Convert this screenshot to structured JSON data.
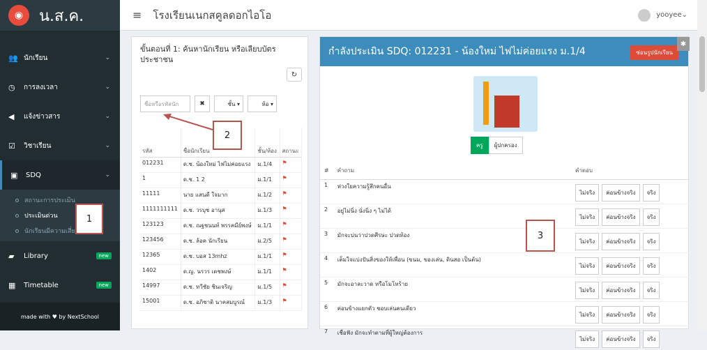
{
  "sidebar": {
    "brand": "น.ส.ค.",
    "items": [
      {
        "label": "นักเรียน"
      },
      {
        "label": "การลงเวลา"
      },
      {
        "label": "แจ้งข่าวสาร"
      },
      {
        "label": "วิชาเรียน"
      },
      {
        "label": "SDQ"
      }
    ],
    "sub": [
      {
        "label": "สถานะการประเมิน"
      },
      {
        "label": "ประเมินด่วน"
      },
      {
        "label": "นักเรียนมีความเสี่ยง"
      }
    ],
    "library": "Library",
    "timetable": "Timetable",
    "new_badge": "new",
    "made": "made with ♥ by NextSchool"
  },
  "topbar": {
    "school": "โรงเรียนเนกสคูลดอกไอโอ",
    "user": "yooyee"
  },
  "left": {
    "title": "ขั้นตอนที่ 1: ค้นหานักเรียน หรือเลียบบัตรประชาชน",
    "search_placeholder": "ชื่อหรือรหัสนัก",
    "grade": "ชั้น",
    "room": "ห้อ",
    "headers": [
      "รหัส",
      "ชื่อนักเรียน",
      "ชั้น/ห้อง",
      "สถานะ"
    ],
    "rows": [
      [
        "012231",
        "ด.ช. น้องใหม่ ไฟไม่ค่อยแรง",
        "ม.1/4"
      ],
      [
        "1",
        "ด.ช. 1 2",
        "ม.1/1"
      ],
      [
        "11111",
        "นาย แสนดี ใจมาก",
        "ม.1/2"
      ],
      [
        "1111111111",
        "ด.ช. วรบุช อานุส",
        "ม.1/3"
      ],
      [
        "123123",
        "ด.ช. ณฐชนนท์ พรรคมีย์พงษ์",
        "ม.1/1"
      ],
      [
        "123456",
        "ด.ช. ล้อค นักเรียน",
        "ม.2/5"
      ],
      [
        "12365",
        "ด.ช. บอส 13mhz",
        "ม.1/1"
      ],
      [
        "1402",
        "ด.ญ. นรวร เดชพงษ์",
        "ม.1/1"
      ],
      [
        "14997",
        "ด.ช. ทวีชัย ชินเจริญ",
        "ม.1/5"
      ],
      [
        "15001",
        "ด.ช. อภิชาติ นาคสมบูรณ์",
        "ม.1/3"
      ]
    ]
  },
  "right": {
    "title": "กำลังประเมิน SDQ: 012231 - น้องใหม่ ไฟไม่ค่อยแรง ม.1/4",
    "hide_btn": "ซ่อนรูปนักเรียน",
    "roles": [
      "ครู",
      "ผู้ปกครอง"
    ],
    "headers": [
      "#",
      "คำถาม",
      "คำตอบ"
    ],
    "answers": [
      "ไม่จริง",
      "ค่อนข้างจริง",
      "จริง"
    ],
    "questions": [
      {
        "n": "1",
        "q": "ห่วงใยความรู้สึกคนอื่น"
      },
      {
        "n": "2",
        "q": "อยู่ไม่นิ่ง นั่งนิ่ง ๆ ไม่ได้"
      },
      {
        "n": "3",
        "q": "มักจะบ่นว่าปวดศีรษะ ปวดท้อง"
      },
      {
        "n": "4",
        "q": "เต็มใจแบ่งปันสิ่งของให้เพื่อน (ขนม, ของเล่น, ดินสอ เป็นต้น)"
      },
      {
        "n": "5",
        "q": "มักจะอาละวาด หรือโมโหร้าย"
      },
      {
        "n": "6",
        "q": "ค่อนข้างแยกตัว ชอบเล่นคนเดียว"
      },
      {
        "n": "7",
        "q": "เชื่อฟัง มักจะทำตามที่ผู้ใหญ่ต้องการ"
      }
    ]
  },
  "callouts": {
    "c1": "1",
    "c2": "2",
    "c3": "3"
  }
}
